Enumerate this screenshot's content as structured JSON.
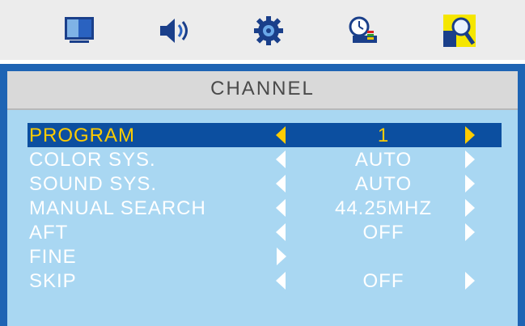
{
  "menu": {
    "title": "CHANNEL",
    "items": [
      {
        "label": "PROGRAM",
        "value": "1",
        "has_left": true,
        "has_right": true,
        "selected": true
      },
      {
        "label": "COLOR  SYS.",
        "value": "AUTO",
        "has_left": true,
        "has_right": true,
        "selected": false
      },
      {
        "label": "SOUND  SYS.",
        "value": "AUTO",
        "has_left": true,
        "has_right": true,
        "selected": false
      },
      {
        "label": "MANUAL SEARCH",
        "value": "44.25MHZ",
        "has_left": true,
        "has_right": true,
        "selected": false
      },
      {
        "label": "AFT",
        "value": "OFF",
        "has_left": true,
        "has_right": true,
        "selected": false
      },
      {
        "label": "FINE",
        "value": "",
        "has_left": false,
        "has_right": true,
        "selected": false
      },
      {
        "label": "SKIP",
        "value": "OFF",
        "has_left": true,
        "has_right": true,
        "selected": false
      }
    ]
  },
  "tabs": [
    {
      "icon": "picture-icon"
    },
    {
      "icon": "sound-icon"
    },
    {
      "icon": "setup-icon"
    },
    {
      "icon": "time-icon"
    },
    {
      "icon": "channel-search-icon",
      "active": true
    }
  ],
  "colors": {
    "selected_text": "#ffcc00",
    "selected_bg": "#0c4fa0",
    "panel_bg": "#a9d7f2",
    "frame": "#1e64b4"
  }
}
